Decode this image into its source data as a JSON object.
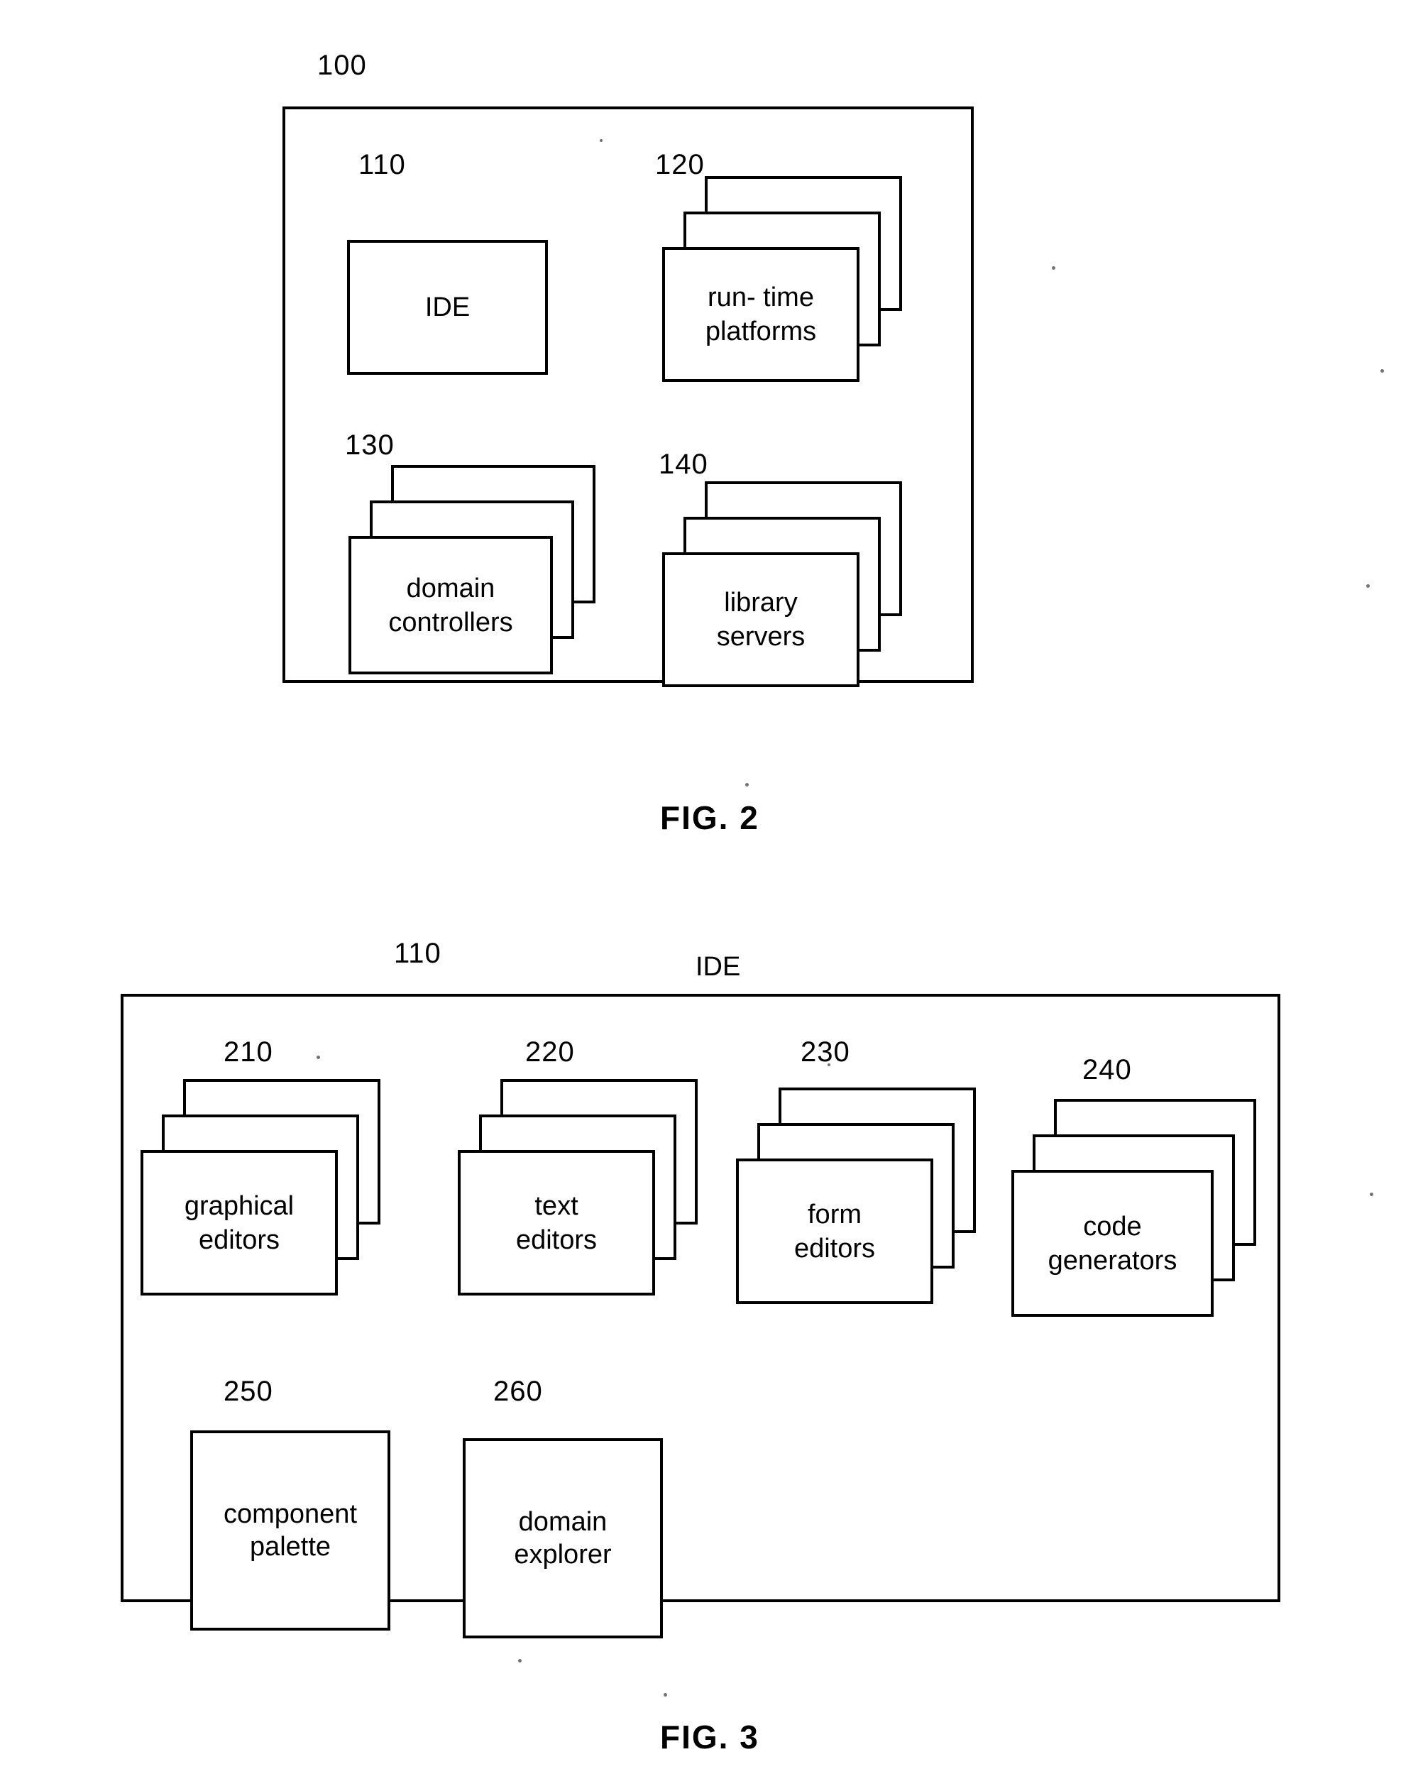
{
  "document": {
    "type": "patent-drawing-sheet",
    "figures": [
      "FIG. 2",
      "FIG. 3"
    ]
  },
  "fig2": {
    "caption": "FIG. 2",
    "outer_ref": "100",
    "nodes": [
      {
        "ref": "110",
        "label": "IDE",
        "style": "single"
      },
      {
        "ref": "120",
        "label": "run- time\nplatforms",
        "style": "stack"
      },
      {
        "ref": "130",
        "label": "domain\ncontrollers",
        "style": "stack"
      },
      {
        "ref": "140",
        "label": "library\nservers",
        "style": "stack"
      }
    ]
  },
  "fig3": {
    "caption": "FIG. 3",
    "outer_ref": "110",
    "outer_title": "IDE",
    "nodes": [
      {
        "ref": "210",
        "label": "graphical\neditors",
        "style": "stack"
      },
      {
        "ref": "220",
        "label": "text\neditors",
        "style": "stack"
      },
      {
        "ref": "230",
        "label": "form\neditors",
        "style": "stack"
      },
      {
        "ref": "240",
        "label": "code\ngenerators",
        "style": "stack"
      },
      {
        "ref": "250",
        "label": "component\npalette",
        "style": "single"
      },
      {
        "ref": "260",
        "label": "domain\nexplorer",
        "style": "single"
      }
    ]
  },
  "colors": {
    "ink": "#000000",
    "paper": "#ffffff"
  }
}
